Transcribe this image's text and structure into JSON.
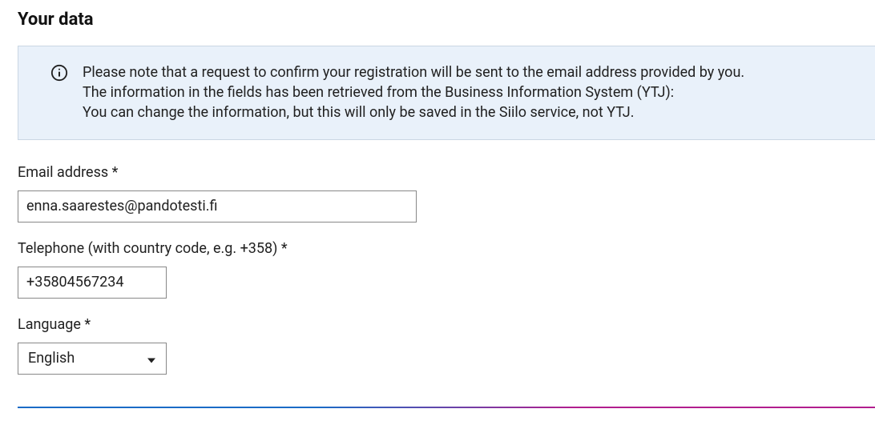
{
  "section": {
    "title": "Your data"
  },
  "info": {
    "line1": "Please note that a request to confirm your registration will be sent to the email address provided by you.",
    "line2": "The information in the fields has been retrieved from the Business Information System (YTJ):",
    "line3": "You can change the information, but this will only be saved in the Siilo service, not YTJ."
  },
  "form": {
    "email": {
      "label": "Email address *",
      "value": "enna.saarestes@pandotesti.fi"
    },
    "telephone": {
      "label": "Telephone (with country code, e.g. +358) *",
      "value": "+35804567234"
    },
    "language": {
      "label": "Language *",
      "selected": "English"
    }
  }
}
